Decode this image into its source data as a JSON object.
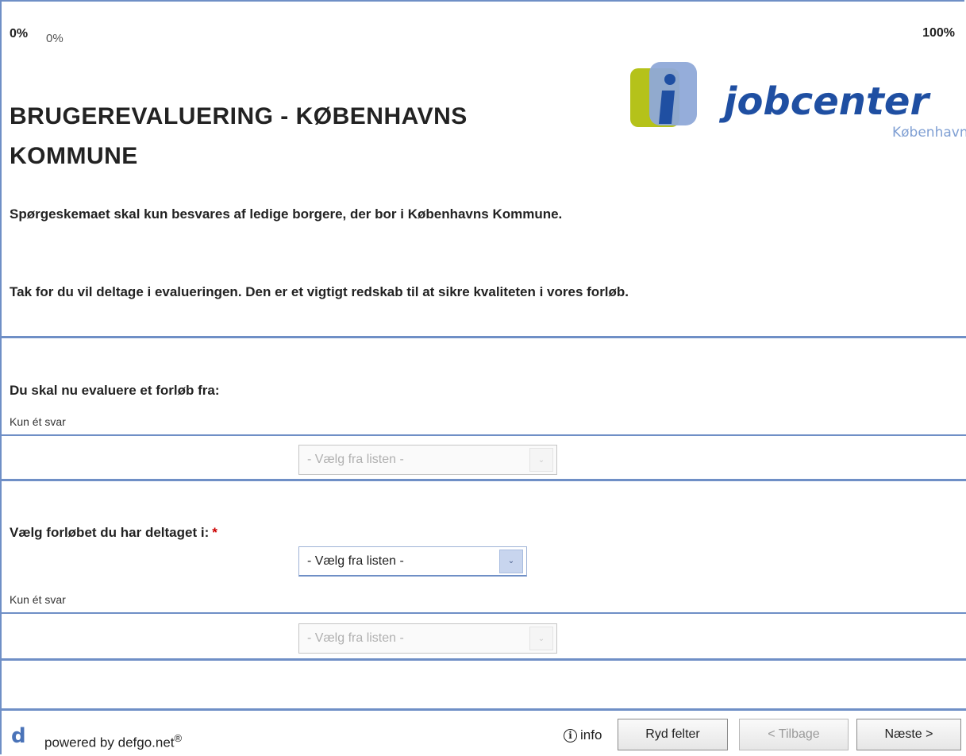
{
  "progress": {
    "left_bold": "0%",
    "left_small": "0%",
    "right_bold": "100%",
    "value_percent": 0
  },
  "logo": {
    "text": "jobcenter",
    "subtext": "København",
    "colors": {
      "green": "#b5c21a",
      "blue": "#7f9fd3",
      "text": "#1f4fa2"
    }
  },
  "header": {
    "title": "BRUGEREVALUERING - KØBENHAVNS KOMMUNE",
    "intro_1": "Spørgeskemaet skal kun besvares af ledige borgere, der bor i Københavns Kommune.",
    "intro_2": "Tak for du vil deltage i evalueringen. Den er et vigtigt redskab til at sikre kvaliteten i vores forløb."
  },
  "question1": {
    "title": "Du skal nu evaluere et forløb fra:",
    "hint": "Kun ét svar",
    "select_value": "- Vælg fra listen -"
  },
  "question2": {
    "title": "Vælg forløbet du har deltaget i:",
    "required_mark": "*",
    "select_value": "- Vælg fra listen -",
    "hint": "Kun ét svar",
    "select2_value": "- Vælg fra listen -"
  },
  "footer": {
    "brand_letter": "d",
    "powered_by": "powered by defgo.net",
    "registered": "®",
    "info_icon": "i",
    "info_label": "info",
    "clear_button": "Ryd felter",
    "back_button": "< Tilbage",
    "next_button": "Næste >"
  },
  "colors": {
    "accent": "#6f8fc6",
    "required": "#cc0000"
  }
}
